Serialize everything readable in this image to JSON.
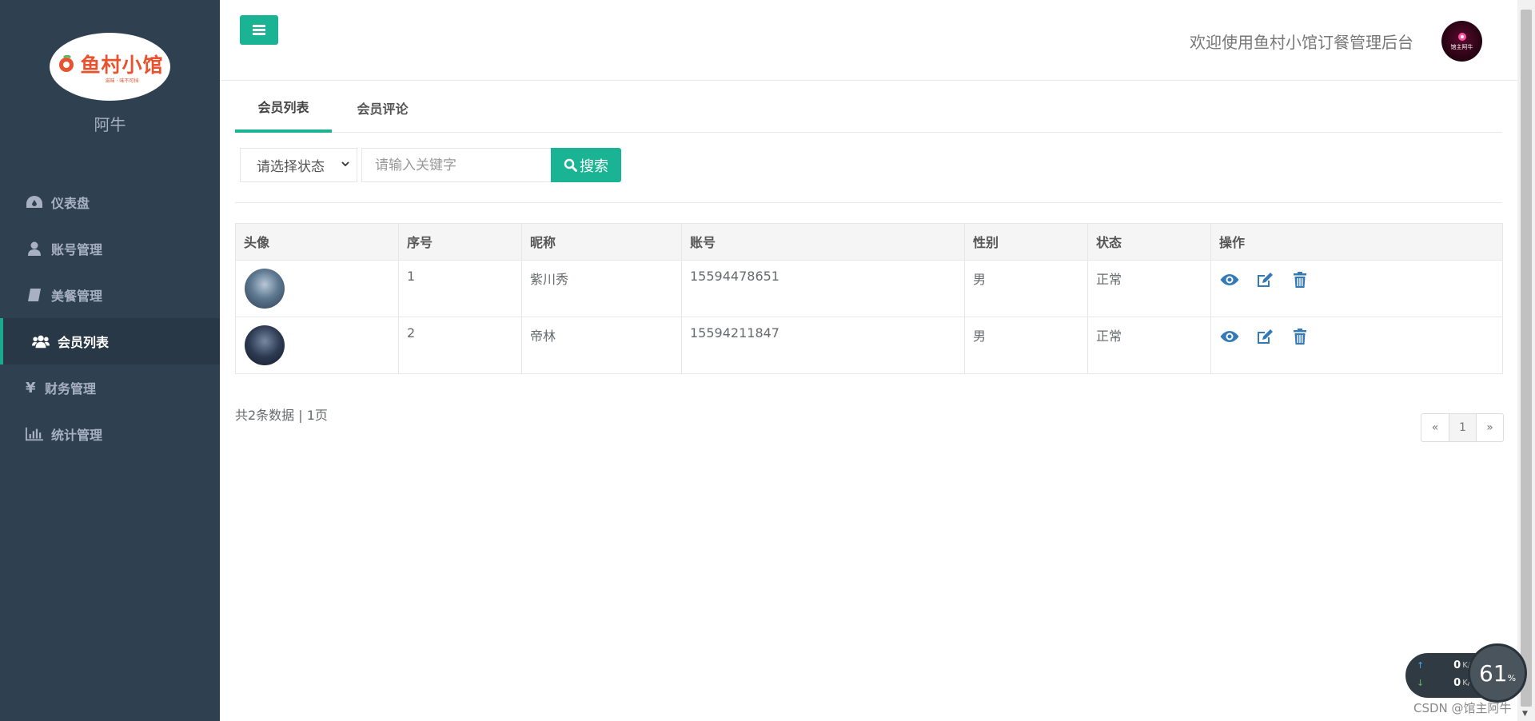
{
  "sidebar": {
    "logo": {
      "text": "鱼村小馆",
      "sub": "滋味 · 味不可挡"
    },
    "user_name": "阿牛",
    "items": [
      {
        "label": "仪表盘",
        "icon": "dashboard-icon"
      },
      {
        "label": "账号管理",
        "icon": "user-icon"
      },
      {
        "label": "美餐管理",
        "icon": "book-icon"
      },
      {
        "label": "会员列表",
        "icon": "users-icon"
      },
      {
        "label": "财务管理",
        "icon": "yen-icon"
      },
      {
        "label": "统计管理",
        "icon": "bar-chart-icon"
      }
    ],
    "active_index": 3
  },
  "header": {
    "welcome": "欢迎使用鱼村小馆订餐管理后台",
    "avatar_text": "馆主阿牛"
  },
  "tabs": [
    {
      "label": "会员列表",
      "active": true
    },
    {
      "label": "会员评论",
      "active": false
    }
  ],
  "search": {
    "status_select": "请选择状态",
    "keyword_placeholder": "请输入关键字",
    "keyword_value": "",
    "button_label": "搜索"
  },
  "table": {
    "columns": [
      "头像",
      "序号",
      "昵称",
      "账号",
      "性别",
      "状态",
      "操作"
    ],
    "rows": [
      {
        "index": "1",
        "nickname": "紫川秀",
        "account": "15594478651",
        "gender": "男",
        "status": "正常"
      },
      {
        "index": "2",
        "nickname": "帝林",
        "account": "15594211847",
        "gender": "男",
        "status": "正常"
      }
    ]
  },
  "footer": {
    "summary": "共2条数据 | 1页",
    "pager": {
      "prev": "«",
      "current": "1",
      "next": "»"
    }
  },
  "net_widget": {
    "up": "0",
    "down": "0",
    "unit": "K/s",
    "percent": "61",
    "percent_sign": "%"
  },
  "watermark": "CSDN @馆主阿牛",
  "colors": {
    "accent": "#1ab394",
    "sidebar_bg": "#2f4050",
    "link_icon": "#337ab7"
  }
}
